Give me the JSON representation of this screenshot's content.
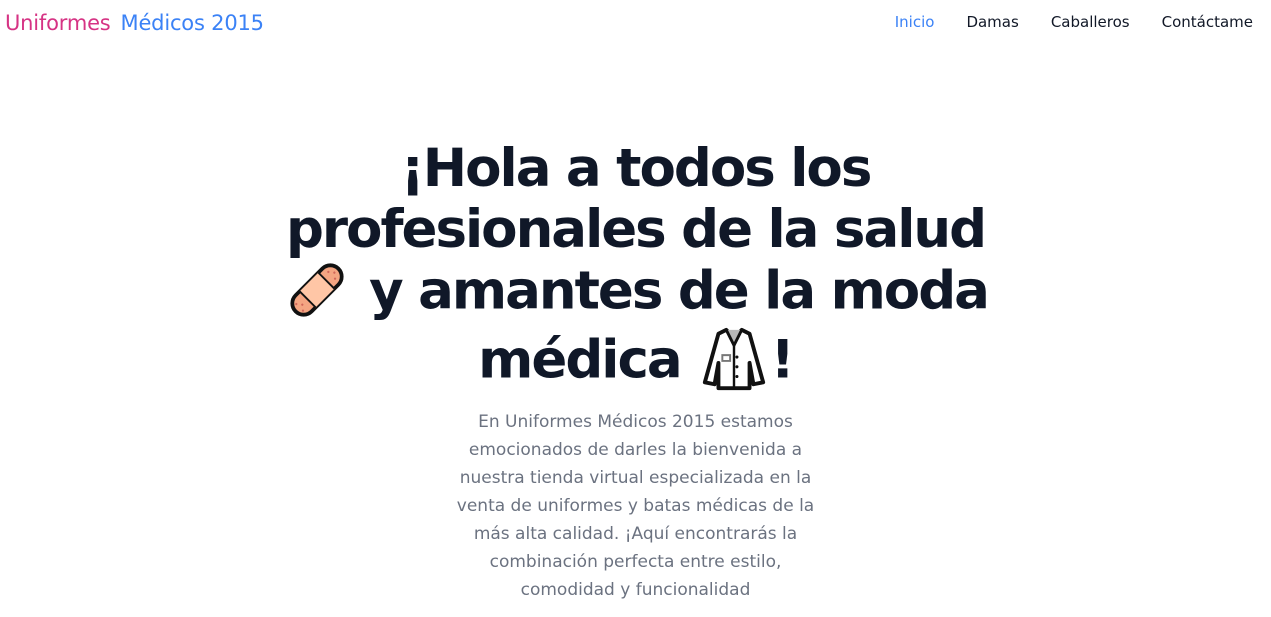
{
  "brand": {
    "part1": "Uniformes",
    "part2": "Médicos 2015"
  },
  "nav": {
    "items": [
      "Inicio",
      "Damas",
      "Caballeros",
      "Contáctame"
    ],
    "active": "Inicio"
  },
  "hero": {
    "line1": "¡Hola a todos los",
    "line2": "profesionales de la salud",
    "line3": "y amantes de la moda",
    "line4": "médica",
    "line4_suffix": "!",
    "description": "En Uniformes Médicos 2015 estamos emocionados de darles la bienvenida a nuestra tienda virtual especializada en la venta de uniformes y batas médicas de la más alta calidad. ¡Aquí encontrarás la combinación perfecta entre estilo, comodidad y funcionalidad"
  },
  "icons": {
    "bandage": "adhesive-bandage-icon",
    "coat": "lab-coat-icon"
  },
  "colors": {
    "brand_pink": "#d63384",
    "brand_blue": "#3b82f6",
    "nav_text": "#111827",
    "heading": "#101828",
    "body_text": "#6b7280"
  }
}
